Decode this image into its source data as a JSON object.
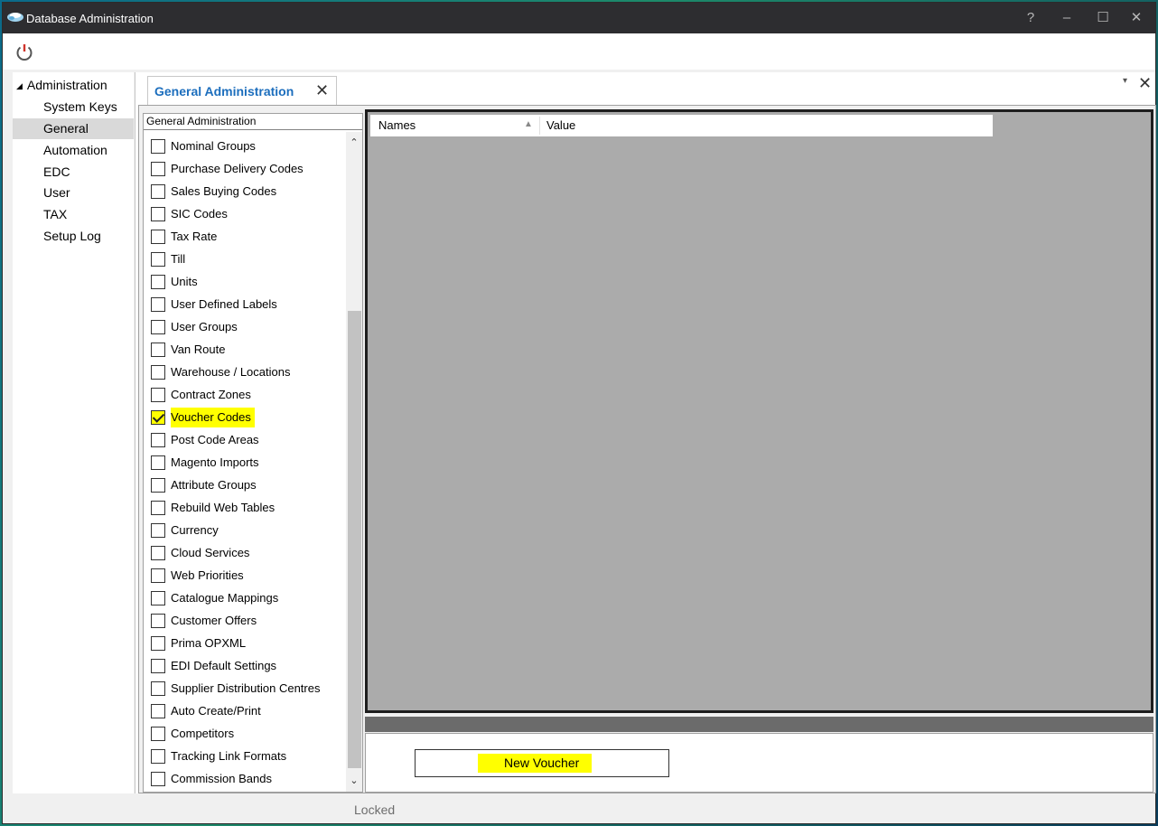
{
  "window": {
    "title": "Database Administration",
    "controls": {
      "help": "?",
      "minimize": "–",
      "maximize": "☐",
      "close": "✕"
    }
  },
  "toolbar": {
    "power_icon": "power-icon"
  },
  "nav": {
    "root_label": "Administration",
    "items": [
      {
        "label": "System Keys"
      },
      {
        "label": "General",
        "selected": true
      },
      {
        "label": "Automation"
      },
      {
        "label": "EDC"
      },
      {
        "label": "User"
      },
      {
        "label": "TAX"
      },
      {
        "label": "Setup Log"
      }
    ]
  },
  "tabs": {
    "active_label": "General Administration",
    "close_symbol": "✕",
    "menu_symbol": "▾",
    "close_all_symbol": "✕"
  },
  "list": {
    "header": "General Administration",
    "items": [
      {
        "label": "Nominal Groups",
        "checked": false
      },
      {
        "label": "Purchase Delivery Codes",
        "checked": false
      },
      {
        "label": "Sales Buying Codes",
        "checked": false
      },
      {
        "label": "SIC Codes",
        "checked": false
      },
      {
        "label": "Tax Rate",
        "checked": false
      },
      {
        "label": "Till",
        "checked": false
      },
      {
        "label": "Units",
        "checked": false
      },
      {
        "label": "User Defined Labels",
        "checked": false
      },
      {
        "label": "User Groups",
        "checked": false
      },
      {
        "label": "Van Route",
        "checked": false
      },
      {
        "label": "Warehouse / Locations",
        "checked": false
      },
      {
        "label": "Contract Zones",
        "checked": false
      },
      {
        "label": "Voucher Codes",
        "checked": true,
        "highlight": true
      },
      {
        "label": "Post Code Areas",
        "checked": false
      },
      {
        "label": "Magento Imports",
        "checked": false
      },
      {
        "label": "Attribute Groups",
        "checked": false
      },
      {
        "label": "Rebuild Web Tables",
        "checked": false
      },
      {
        "label": "Currency",
        "checked": false
      },
      {
        "label": "Cloud Services",
        "checked": false
      },
      {
        "label": "Web Priorities",
        "checked": false
      },
      {
        "label": "Catalogue Mappings",
        "checked": false
      },
      {
        "label": "Customer Offers",
        "checked": false
      },
      {
        "label": "Prima OPXML",
        "checked": false
      },
      {
        "label": "EDI Default Settings",
        "checked": false
      },
      {
        "label": "Supplier Distribution Centres",
        "checked": false
      },
      {
        "label": "Auto Create/Print",
        "checked": false
      },
      {
        "label": "Competitors",
        "checked": false
      },
      {
        "label": "Tracking Link Formats",
        "checked": false
      },
      {
        "label": "Commission Bands",
        "checked": false
      }
    ],
    "scroll_up": "⌃",
    "scroll_down": "⌄"
  },
  "grid": {
    "columns": [
      "Names",
      "Value"
    ],
    "sort_indicator": "▲"
  },
  "actions": {
    "new_voucher_label": "New Voucher"
  },
  "status": {
    "text": "Locked"
  },
  "colors": {
    "titlebar": "#2d2d30",
    "tab_label": "#1c6ebd",
    "highlight": "#ffff00",
    "grid_background": "#ababab"
  }
}
